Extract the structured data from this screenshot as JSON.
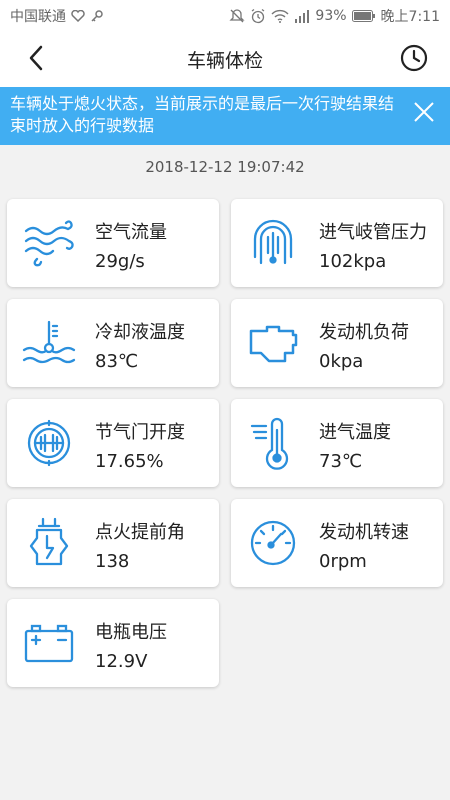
{
  "status_bar": {
    "carrier": "中国联通",
    "battery": "93%",
    "time": "晚上7:11"
  },
  "header": {
    "title": "车辆体检"
  },
  "notice": {
    "text": "车辆处于熄火状态，当前展示的是最后一次行驶结果结束时放入的行驶数据"
  },
  "timestamp": "2018-12-12 19:07:42",
  "accent_color": "#2a8fdc",
  "banner_color": "#41aef2",
  "metrics": [
    {
      "label": "空气流量",
      "value": "29g/s",
      "icon": "air-flow-icon"
    },
    {
      "label": "进气岐管压力",
      "value": "102kpa",
      "icon": "intake-manifold-pressure-icon"
    },
    {
      "label": "冷却液温度",
      "value": "83℃",
      "icon": "coolant-temperature-icon"
    },
    {
      "label": "发动机负荷",
      "value": "0kpa",
      "icon": "engine-load-icon"
    },
    {
      "label": "节气门开度",
      "value": "17.65%",
      "icon": "throttle-icon"
    },
    {
      "label": "进气温度",
      "value": "73℃",
      "icon": "intake-temperature-icon"
    },
    {
      "label": "点火提前角",
      "value": "138",
      "icon": "ignition-advance-icon"
    },
    {
      "label": "发动机转速",
      "value": "0rpm",
      "icon": "engine-speed-gauge-icon"
    },
    {
      "label": "电瓶电压",
      "value": "12.9V",
      "icon": "battery-icon"
    }
  ]
}
